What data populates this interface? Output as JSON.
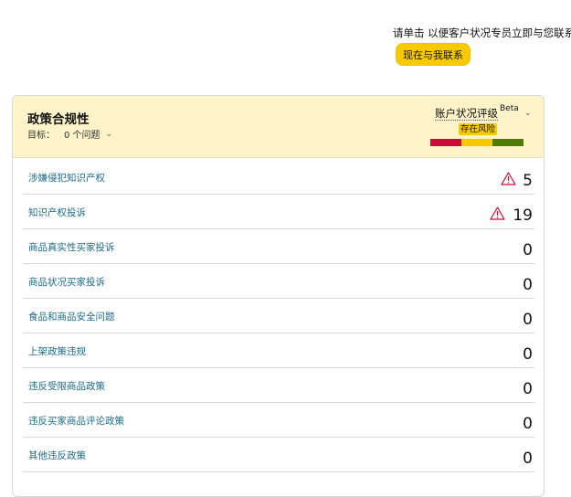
{
  "contact": {
    "text": "请单击 以便客户状况专员立即与您联系。",
    "button_label": "现在与我联系"
  },
  "policy": {
    "title": "政策合规性",
    "target_label": "目标：",
    "target_value": "0 个问题",
    "rating_label": "账户状况评级",
    "beta_label": "Beta",
    "status_label": "存在风险",
    "status_colors": [
      "#cc0c39",
      "#f7ca00",
      "#4e7d05"
    ],
    "rows": [
      {
        "label": "涉嫌侵犯知识产权",
        "value": "5",
        "warning": true
      },
      {
        "label": "知识产权投诉",
        "value": "19",
        "warning": true
      },
      {
        "label": "商品真实性买家投诉",
        "value": "0",
        "warning": false
      },
      {
        "label": "商品状况买家投诉",
        "value": "0",
        "warning": false
      },
      {
        "label": "食品和商品安全问题",
        "value": "0",
        "warning": false
      },
      {
        "label": "上架政策违规",
        "value": "0",
        "warning": false
      },
      {
        "label": "违反受限商品政策",
        "value": "0",
        "warning": false
      },
      {
        "label": "违反买家商品评论政策",
        "value": "0",
        "warning": false
      },
      {
        "label": "其他违反政策",
        "value": "0",
        "warning": false
      }
    ]
  }
}
